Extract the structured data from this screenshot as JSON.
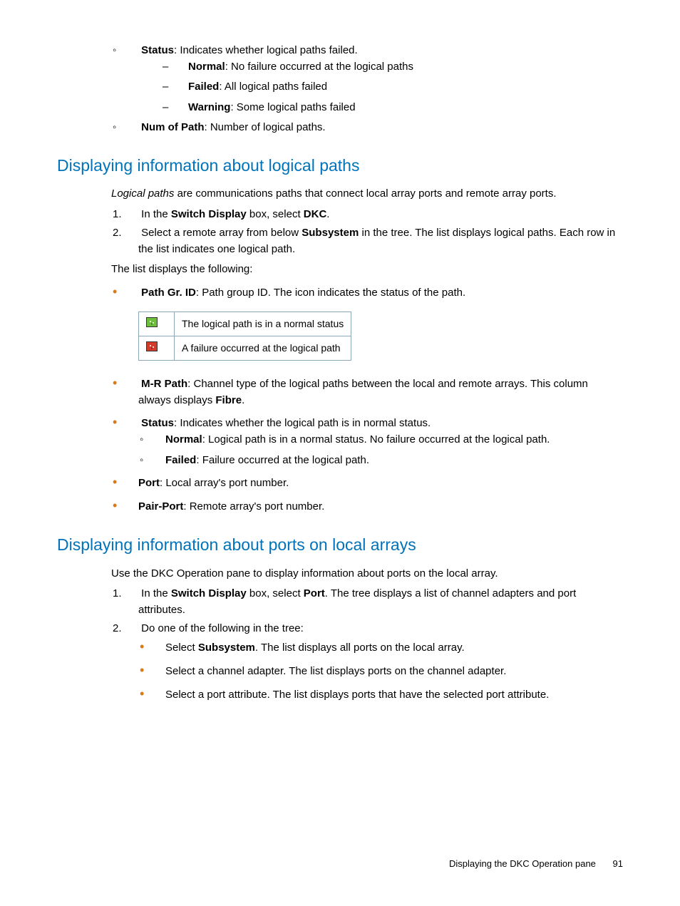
{
  "top": {
    "status": {
      "label": "Status",
      "text": ": Indicates whether logical paths failed."
    },
    "status_sub": {
      "normal": {
        "label": "Normal",
        "text": ": No failure occurred at the logical paths"
      },
      "failed": {
        "label": "Failed",
        "text": ": All logical paths failed"
      },
      "warning": {
        "label": "Warning",
        "text": ": Some logical paths failed"
      }
    },
    "numpath": {
      "label": "Num of Path",
      "text": ": Number of logical paths."
    }
  },
  "section1": {
    "title": "Displaying information about logical paths",
    "intro_prefix": "Logical paths",
    "intro_rest": " are communications paths that connect local array ports and remote array ports.",
    "step1_pre": "In the ",
    "step1_box": "Switch Display",
    "step1_mid": " box, select ",
    "step1_opt": "DKC",
    "step1_end": ".",
    "step2_pre": "Select a remote array from below ",
    "step2_bold": "Subsystem",
    "step2_rest": " in the tree. The list displays logical paths. Each row in the list indicates one logical path.",
    "list_intro": "The list displays the following:",
    "pathgr": {
      "label": "Path Gr. ID",
      "text": ": Path group ID. The icon indicates the status of the path."
    },
    "table": {
      "row1": "The logical path is in a normal status",
      "row2": "A failure occurred at the logical path"
    },
    "mrpath": {
      "label": "M-R Path",
      "pre": ": Channel type of the logical paths between the local and remote arrays. This column always displays ",
      "fibre": "Fibre",
      "end": "."
    },
    "status2": {
      "label": "Status",
      "text": ": Indicates whether the logical path is in normal status."
    },
    "status2_sub": {
      "normal": {
        "label": "Normal",
        "text": ": Logical path is in a normal status. No failure occurred at the logical path."
      },
      "failed": {
        "label": "Failed",
        "text": ": Failure occurred at the logical path."
      }
    },
    "port": {
      "label": "Port",
      "text": ": Local array's port number."
    },
    "pairport": {
      "label": "Pair-Port",
      "text": ": Remote array's port number."
    }
  },
  "section2": {
    "title": "Displaying information about ports on local arrays",
    "intro": "Use the DKC Operation pane to display information about ports on the local array.",
    "step1_pre": "In the ",
    "step1_box": "Switch Display",
    "step1_mid": " box, select ",
    "step1_opt": "Port",
    "step1_rest": ". The tree displays a list of channel adapters and port attributes.",
    "step2": "Do one of the following in the tree:",
    "sub1_pre": "Select ",
    "sub1_bold": "Subsystem",
    "sub1_rest": ". The list displays all ports on the local array.",
    "sub2": "Select a channel adapter. The list displays ports on the channel adapter.",
    "sub3": "Select a port attribute. The list displays ports that have the selected port attribute."
  },
  "footer": {
    "text": "Displaying the DKC Operation pane",
    "page": "91"
  }
}
